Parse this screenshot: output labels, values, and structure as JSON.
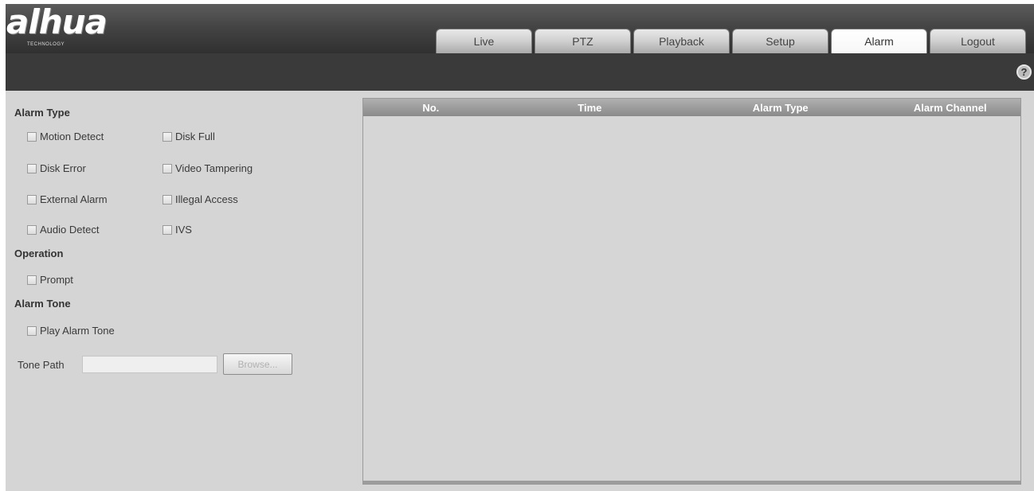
{
  "brand": {
    "logo_text": "alhua",
    "logo_sub": "TECHNOLOGY"
  },
  "nav": {
    "tabs": [
      {
        "label": "Live",
        "active": false
      },
      {
        "label": "PTZ",
        "active": false
      },
      {
        "label": "Playback",
        "active": false
      },
      {
        "label": "Setup",
        "active": false
      },
      {
        "label": "Alarm",
        "active": true
      },
      {
        "label": "Logout",
        "active": false
      }
    ],
    "help_icon": "?"
  },
  "alarm_type": {
    "title": "Alarm Type",
    "options": [
      {
        "label": "Motion Detect",
        "checked": false
      },
      {
        "label": "Disk Full",
        "checked": false
      },
      {
        "label": "Disk Error",
        "checked": false
      },
      {
        "label": "Video Tampering",
        "checked": false
      },
      {
        "label": "External Alarm",
        "checked": false
      },
      {
        "label": "Illegal Access",
        "checked": false
      },
      {
        "label": "Audio Detect",
        "checked": false
      },
      {
        "label": "IVS",
        "checked": false
      }
    ]
  },
  "operation": {
    "title": "Operation",
    "prompt_label": "Prompt",
    "prompt_checked": false
  },
  "alarm_tone": {
    "title": "Alarm Tone",
    "play_label": "Play Alarm Tone",
    "play_checked": false,
    "tone_path_label": "Tone Path",
    "tone_path_value": "",
    "browse_label": "Browse..."
  },
  "table": {
    "columns": [
      "No.",
      "Time",
      "Alarm Type",
      "Alarm Channel"
    ],
    "rows": []
  },
  "colors": {
    "header_dark": "#3a3a3a",
    "panel_bg": "#d5d5d5",
    "table_header": "#9a9a9a"
  }
}
